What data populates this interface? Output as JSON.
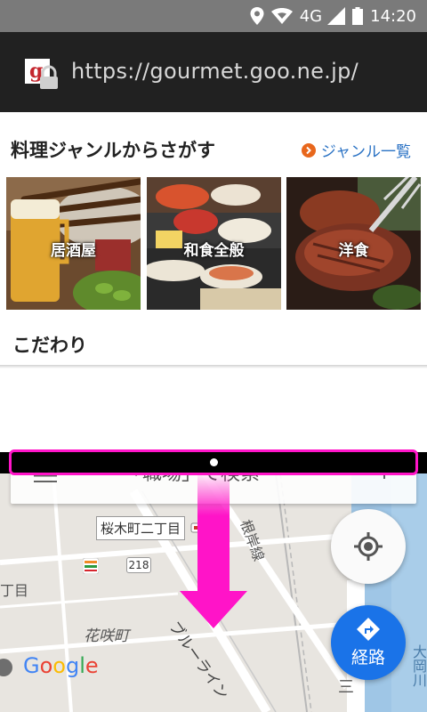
{
  "status_bar": {
    "network": "4G",
    "time": "14:20"
  },
  "url_bar": {
    "url": "https://gourmet.goo.ne.jp/"
  },
  "genre_section": {
    "title": "料理ジャンルからさがす",
    "link": "ジャンル一覧",
    "cards": [
      {
        "label": "居酒屋"
      },
      {
        "label": "和食全般"
      },
      {
        "label": "洋食"
      }
    ]
  },
  "kodawari": {
    "title": "こだわり"
  },
  "map": {
    "search_query": "「職場」で検索",
    "labels": {
      "poi": "桜木町二丁目",
      "road_number": "218",
      "line_name": "根岸線",
      "area_hanasaki": "花咲町",
      "blue_line": "ブルーライン",
      "left_cut": "丁目",
      "right_vertical": "大岡川",
      "bottom_vertical": "三"
    },
    "route_button": "経路",
    "logo": "Google"
  },
  "colors": {
    "highlight": "#ff14c8",
    "link_blue": "#2a72c4",
    "route_blue": "#1a73e8"
  }
}
